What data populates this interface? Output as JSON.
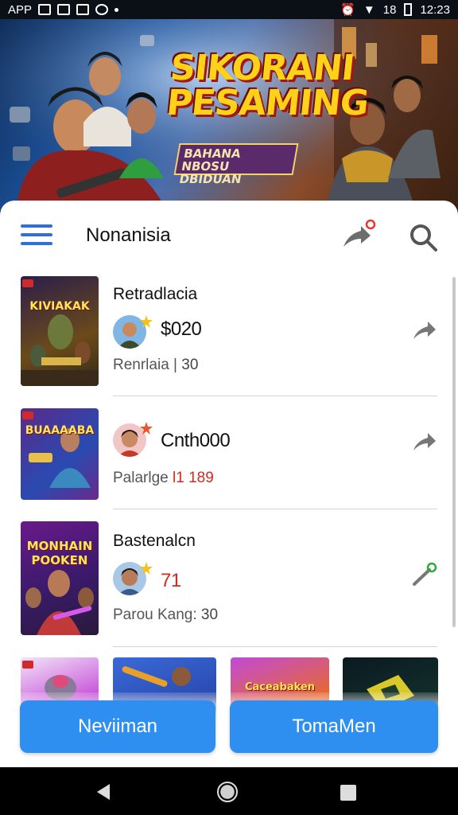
{
  "statusbar": {
    "app_label": "APP",
    "signal_text": "18",
    "time": "12:23"
  },
  "banner": {
    "title_line1": "SIKORANI",
    "title_line2": "PESAMING",
    "subtitle_line1": "BAHANA NBOSU",
    "subtitle_line2": "DBIDUAN"
  },
  "appbar": {
    "title": "Nonanisia",
    "menu_icon": "hamburger-menu-icon",
    "share_icon": "share-icon",
    "search_icon": "search-icon"
  },
  "rows": [
    {
      "title": "Retradlacia",
      "thumb_label": "KIVIAKAK",
      "value": "$020",
      "meta_label": "Renrlaia",
      "meta_sep": "|",
      "meta_value": "30"
    },
    {
      "title": "",
      "thumb_label": "BUAAAABA",
      "value": "Cnth000",
      "meta_label": "Palarlge",
      "meta_sep": "l1",
      "meta_value": "189"
    },
    {
      "title": "Bastenalcn",
      "thumb_label": "MONHAIN POOKEN",
      "value": "71",
      "meta_label": "Parou Kang:",
      "meta_sep": "",
      "meta_value": "30"
    }
  ],
  "grid_labels": [
    "",
    "",
    "Caceabaken",
    ""
  ],
  "buttons": {
    "left": "Neviiman",
    "right": "TomaMen"
  },
  "colors": {
    "accent": "#2f8ff0",
    "menu": "#2f6fd6",
    "highlight": "#d42a1e"
  }
}
